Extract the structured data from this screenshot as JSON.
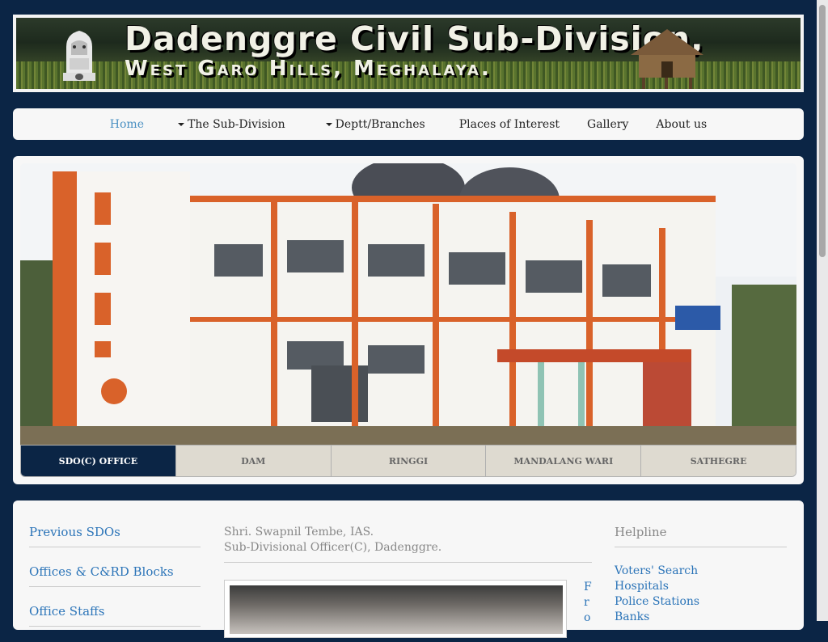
{
  "banner": {
    "title": "Dadenggre Civil Sub-Division,",
    "subtitle": "West Garo Hills, Meghalaya."
  },
  "nav": {
    "items": [
      {
        "label": "Home",
        "active": true,
        "dropdown": false
      },
      {
        "label": "The Sub-Division",
        "active": false,
        "dropdown": true
      },
      {
        "label": "Deptt/Branches",
        "active": false,
        "dropdown": true
      },
      {
        "label": "Places of Interest",
        "active": false,
        "dropdown": false
      },
      {
        "label": "Gallery",
        "active": false,
        "dropdown": false
      },
      {
        "label": "About us",
        "active": false,
        "dropdown": false
      }
    ]
  },
  "slider": {
    "tabs": [
      {
        "label": "SDO(C) OFFICE",
        "active": true
      },
      {
        "label": "DAM",
        "active": false
      },
      {
        "label": "RINGGI",
        "active": false
      },
      {
        "label": "MANDALANG WARI",
        "active": false
      },
      {
        "label": "SATHEGRE",
        "active": false
      }
    ]
  },
  "sidebar": {
    "links": [
      "Previous SDOs",
      "Offices & C&RD Blocks",
      "Office Staffs"
    ]
  },
  "officer": {
    "name": "Shri. Swapnil Tembe, IAS.",
    "designation": "Sub-Divisional Officer(C), Dadenggre.",
    "vertical_text": "Fro"
  },
  "helpline": {
    "title": "Helpline",
    "links": [
      "Voters' Search",
      "Hospitals",
      "Police Stations",
      "Banks"
    ]
  },
  "colors": {
    "page_bg": "#0b2545",
    "link": "#2b74b8",
    "active_nav": "#4a90c2",
    "active_tab": "#0b2545",
    "tab_bg": "#dedad0"
  }
}
